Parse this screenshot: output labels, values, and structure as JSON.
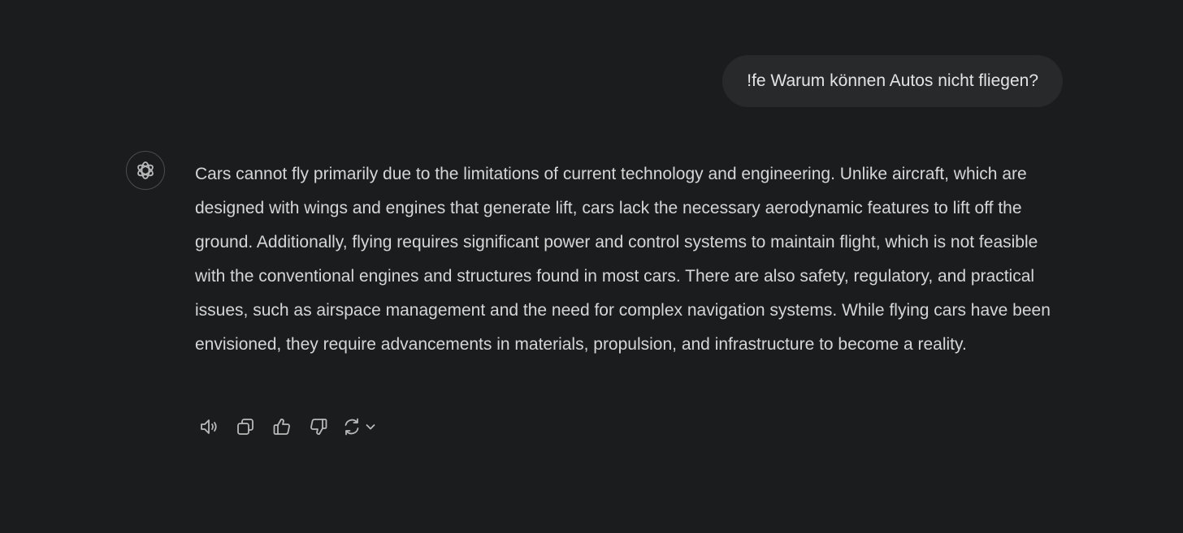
{
  "conversation": {
    "user_message": "!fe Warum können Autos nicht fliegen?",
    "assistant_avatar_icon": "openai-logo-icon",
    "assistant_message": "Cars cannot fly primarily due to the limitations of current technology and engineering. Unlike aircraft, which are designed with wings and engines that generate lift, cars lack the necessary aerodynamic features to lift off the ground. Additionally, flying requires significant power and control systems to maintain flight, which is not feasible with the conventional engines and structures found in most cars. There are also safety, regulatory, and practical issues, such as airspace management and the need for complex navigation systems. While flying cars have been envisioned, they require advancements in materials, propulsion, and infrastructure to become a reality."
  },
  "actions": [
    {
      "icon": "speaker-icon"
    },
    {
      "icon": "copy-icon"
    },
    {
      "icon": "thumbs-up-icon"
    },
    {
      "icon": "thumbs-down-icon"
    },
    {
      "icon": "regenerate-icon"
    }
  ],
  "colors": {
    "background": "#1b1c1e",
    "user_bubble": "#27292b",
    "text": "#d6d6d6",
    "icon": "#b9b9b9"
  }
}
